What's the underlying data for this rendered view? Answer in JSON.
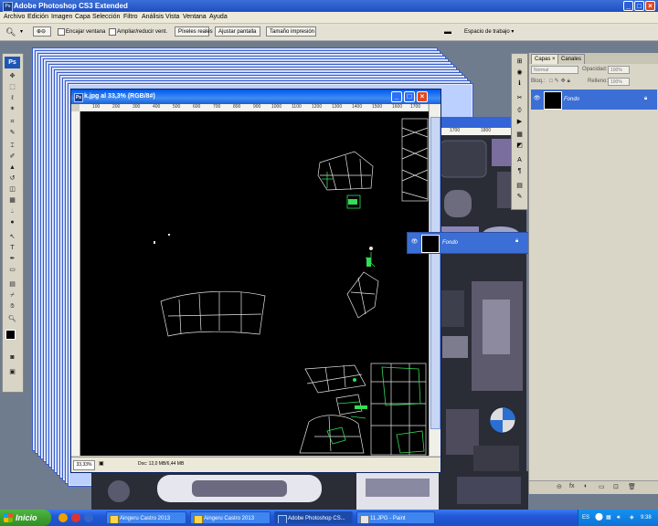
{
  "app": {
    "title": "Adobe Photoshop CS3 Extended",
    "ps_label": "Ps"
  },
  "menu": [
    "Archivo",
    "Edición",
    "Imagen",
    "Capa",
    "Selección",
    "Filtro",
    "Análisis",
    "Vista",
    "Ventana",
    "Ayuda"
  ],
  "options": {
    "fit_window_label": "Encajar ventana",
    "resize_label": "Ampliar/reducir vent.",
    "actual_pixels": "Píxeles reales",
    "fit_screen": "Ajustar pantalla",
    "print_size": "Tamaño impresión",
    "workspace": "Espacio de trabajo ▾"
  },
  "document": {
    "title": "k.jpg al 33,3% (RGB/8#)",
    "zoom": "33,33%",
    "doc_info": "Doc: 12,0 MB/6,44 MB",
    "ruler_labels": [
      "100",
      "200",
      "300",
      "400",
      "500",
      "600",
      "700",
      "800",
      "900",
      "1000",
      "1100",
      "1200",
      "1300",
      "1400",
      "1500",
      "1600",
      "1700",
      "1800"
    ]
  },
  "bg_doc_ruler": [
    "1700",
    "1800"
  ],
  "layers_panel": {
    "tabs": [
      "Capas ×",
      "Canales"
    ],
    "blend_mode": "Normal",
    "opacity_label": "Opacidad:",
    "opacity_value": "100%",
    "lock_label": "Bloq.:",
    "fill_label": "Relleno:",
    "fill_value": "100%",
    "layer_name": "Fondo",
    "footer_icons": [
      "⊝",
      "fx",
      "◐",
      "▭",
      "⊡",
      "🗑"
    ]
  },
  "drag_layer": {
    "name": "Fondo"
  },
  "taskbar": {
    "start": "Inicio",
    "tasks": [
      {
        "label": "Aingeru Castro 2013",
        "active": false
      },
      {
        "label": "Aingeru Castro 2013",
        "active": false
      },
      {
        "label": "Adobe Photoshop CS...",
        "active": true
      },
      {
        "label": "11.JPG - Paint",
        "active": false
      }
    ],
    "lang": "ES",
    "time": "9:38"
  },
  "colors": {
    "xp_blue": "#2158d8",
    "canvas": "#000000",
    "wire_white": "#e6e6e6",
    "wire_green": "#33dd55"
  }
}
